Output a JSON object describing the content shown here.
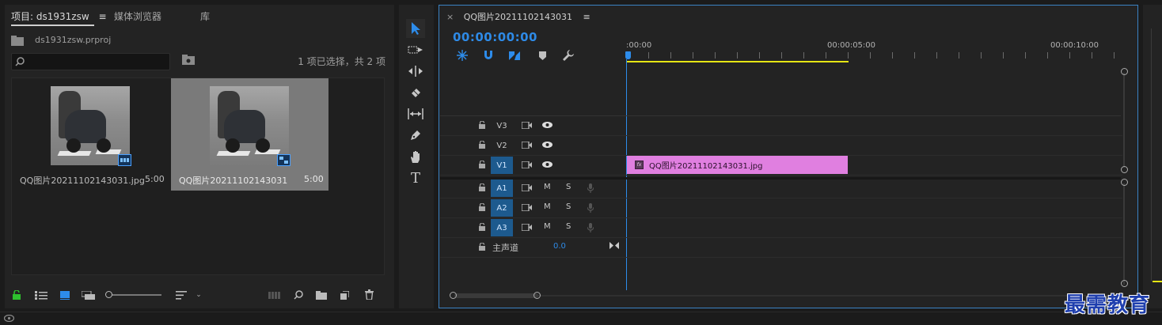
{
  "project_panel": {
    "tab_project": "项目: ds1931zsw",
    "tab_media": "媒体浏览器",
    "tab_library": "库",
    "file_name": "ds1931zsw.prproj",
    "search_placeholder": "",
    "selection_status": "1 项已选择，共 2 项",
    "items": [
      {
        "name": "QQ图片20211102143031.jpg",
        "duration": "5:00"
      },
      {
        "name": "QQ图片20211102143031",
        "duration": "5:00"
      }
    ]
  },
  "timeline": {
    "tab_title": "QQ图片20211102143031",
    "close_glyph": "×",
    "timecode": "00:00:00:00",
    "ruler_labels": [
      ":00:00",
      "00:00:05:00",
      "00:00:10:00"
    ],
    "tracks": {
      "video": [
        "V3",
        "V2",
        "V1"
      ],
      "audio": [
        "A1",
        "A2",
        "A3"
      ]
    },
    "mute_label": "M",
    "solo_label": "S",
    "master_label": "主声道",
    "master_value": "0.0",
    "clip_label": "QQ图片20211102143031.jpg",
    "fx_label": "fx"
  },
  "colors": {
    "accent_blue": "#2d8ceb",
    "timecode_blue": "#2e8ae6",
    "clip_pink": "#e07fe0",
    "work_area_yellow": "#e6e614",
    "track_target_blue": "#1d5a8e",
    "lock_green": "#2ec02e"
  },
  "watermark": "最需教育"
}
